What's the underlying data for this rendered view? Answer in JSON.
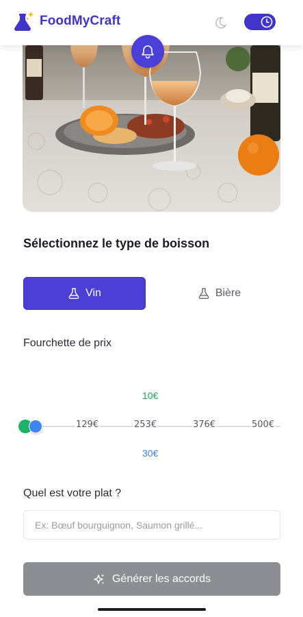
{
  "header": {
    "app_name": "FoodMyCraft",
    "brand_icon": "flask-sparkle-icon",
    "theme_icon": "moon-icon",
    "toggle_icon": "clock-icon"
  },
  "hero": {
    "notification_icon": "bell-icon"
  },
  "drink_section": {
    "title": "Sélectionnez le type de boisson",
    "options": [
      {
        "label": "Vin",
        "icon": "flask-icon",
        "selected": true
      },
      {
        "label": "Bière",
        "icon": "flask-icon",
        "selected": false
      }
    ]
  },
  "price": {
    "label": "Fourchette de prix",
    "min_value": "10€",
    "max_value": "30€",
    "ticks": [
      "129€",
      "253€",
      "376€",
      "500€"
    ]
  },
  "dish": {
    "label": "Quel est votre plat ?",
    "placeholder": "Ex: Bœuf bourguignon, Saumon grillé...",
    "value": ""
  },
  "generate": {
    "label": "Générer les accords",
    "icon": "sparkles-icon"
  },
  "colors": {
    "accent": "#4b3fd6",
    "min_color": "#23a35a",
    "max_color": "#3d7fe0",
    "disabled_button": "#8d8e93"
  }
}
